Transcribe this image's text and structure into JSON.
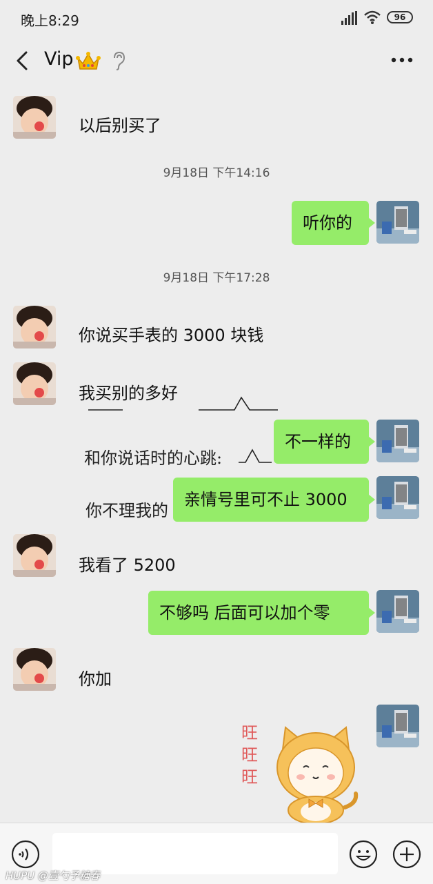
{
  "status": {
    "time": "晚上8:29",
    "battery": "96"
  },
  "header": {
    "title": "Vip"
  },
  "messages": [
    {
      "side": "left",
      "text": "以后别买了"
    },
    {
      "type": "time",
      "text": "9月18日 下午14:16"
    },
    {
      "side": "right",
      "text": "听你的"
    },
    {
      "type": "time",
      "text": "9月18日 下午17:28"
    },
    {
      "side": "left",
      "text": "你说买手表的 3000 块钱"
    },
    {
      "side": "left",
      "text": "我买别的多好"
    },
    {
      "side": "right",
      "text": "不一样的"
    },
    {
      "side": "right",
      "text": "亲情号里可不止 3000"
    },
    {
      "side": "left",
      "text": "我看了 5200"
    },
    {
      "side": "right",
      "text": "不够吗   后面可以加个零"
    },
    {
      "side": "left",
      "text": "你加"
    }
  ],
  "handwritten_sticker": {
    "line1": "和你说话时的心跳:",
    "line2": "你不理我的"
  },
  "wang_sticker": {
    "chars": [
      "旺",
      "旺",
      "旺"
    ]
  },
  "watermark": "HUPU @壹勺予糖春",
  "icons": {
    "back": "back-arrow-icon",
    "ear": "ear-icon",
    "more": "more-icon",
    "voice": "voice-icon",
    "emoji": "emoji-icon",
    "plus": "plus-icon"
  },
  "colors": {
    "background": "#ededed",
    "bubble_right": "#95ec69",
    "input_bar": "#f6f6f6"
  }
}
